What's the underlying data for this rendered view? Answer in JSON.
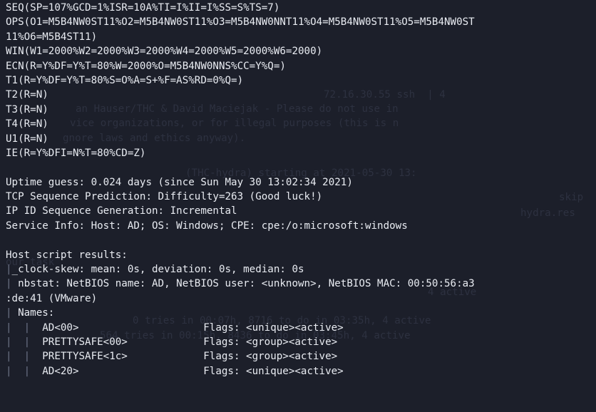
{
  "fingerprint": [
    "SEQ(SP=107%GCD=1%ISR=10A%TI=I%II=I%SS=S%TS=7)",
    "OPS(O1=M5B4NW0ST11%O2=M5B4NW0ST11%O3=M5B4NW0NNT11%O4=M5B4NW0ST11%O5=M5B4NW0ST",
    "11%O6=M5B4ST11)",
    "WIN(W1=2000%W2=2000%W3=2000%W4=2000%W5=2000%W6=2000)",
    "ECN(R=Y%DF=Y%T=80%W=2000%O=M5B4NW0NNS%CC=Y%Q=)",
    "T1(R=Y%DF=Y%T=80%S=O%A=S+%F=AS%RD=0%Q=)",
    "T2(R=N)",
    "T3(R=N)",
    "T4(R=N)",
    "U1(R=N)",
    "IE(R=Y%DFI=N%T=80%CD=Z)"
  ],
  "host_info": [
    "Uptime guess: 0.024 days (since Sun May 30 13:02:34 2021)",
    "TCP Sequence Prediction: Difficulty=263 (Good luck!)",
    "IP ID Sequence Generation: Incremental",
    "Service Info: Host: AD; OS: Windows; CPE: cpe:/o:microsoft:windows"
  ],
  "script_results": {
    "heading": "Host script results:",
    "clock_skew": "_clock-skew: mean: 0s, deviation: 0s, median: 0s",
    "nbstat_1": " nbstat: NetBIOS name: AD, NetBIOS user: <unknown>, NetBIOS MAC: 00:50:56:a3",
    "nbstat_2": ":de:41 (VMware)",
    "names_label": " Names:",
    "names": [
      {
        "name": "AD<00>",
        "flags": "Flags: <unique><active>"
      },
      {
        "name": "PRETTYSAFE<00>",
        "flags": "Flags: <group><active>"
      },
      {
        "name": "PRETTYSAFE<1c>",
        "flags": "Flags: <group><active>"
      },
      {
        "name": "AD<20>",
        "flags": "Flags: <unique><active>"
      }
    ],
    "tree_pipe": "|",
    "tree_pipe_sub": "|  "
  },
  "ghost_text": [
    "72.16.30.55 ssh  | 4",
    "an Hauser/THC & David Maciejak - Please do not use in",
    "vice organizations, or for illegal purposes (this is n",
    "gnore laws and ethics anyway).",
    "(THC-hydra) starting at 2021-05-30 13:",
    "skip",
    "hydra.res",
    "our task",
    "0 tries in 00:07h, 8716 to do in 03:35h, 4 active",
    "564 tries in 00:15h, 8436 to do in 03:45h, 4 active",
    "4 active"
  ]
}
